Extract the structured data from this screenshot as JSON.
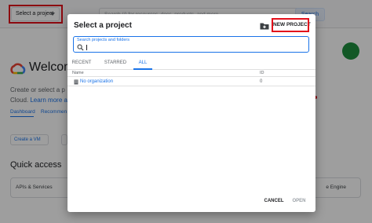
{
  "background": {
    "project_selector": "Select a project",
    "search_placeholder": "Search (/) for resources, docs, products, and more",
    "search_button": "Search",
    "welcome_title": "Welcome",
    "line1_prefix": "Create or select a p",
    "line2_prefix": "Cloud.",
    "line2_link": "Learn more a",
    "tabs": [
      "Dashboard",
      "Recommen"
    ],
    "create_vm": "Create a VM",
    "quick_access_title": "Quick access",
    "quick_access_cards": [
      "APIs & Services",
      "e Engine"
    ]
  },
  "dialog": {
    "title": "Select a project",
    "new_project_label": "NEW PROJECT",
    "search_label": "Search projects and folders",
    "search_value": "",
    "tabs": [
      {
        "label": "RECENT",
        "active": false
      },
      {
        "label": "STARRED",
        "active": false
      },
      {
        "label": "ALL",
        "active": true
      }
    ],
    "table": {
      "columns": [
        "Name",
        "ID"
      ],
      "rows": [
        {
          "name": "No organization",
          "id": "0"
        }
      ]
    },
    "cancel_label": "CANCEL",
    "open_label": "OPEN"
  },
  "colors": {
    "accent": "#1a73e8",
    "highlight": "#e3101b",
    "avatar": "#1e8e3e"
  },
  "icons": [
    "google-cloud-logo-icon",
    "caret-down-icon",
    "folder-add-icon",
    "search-icon",
    "organization-icon"
  ]
}
